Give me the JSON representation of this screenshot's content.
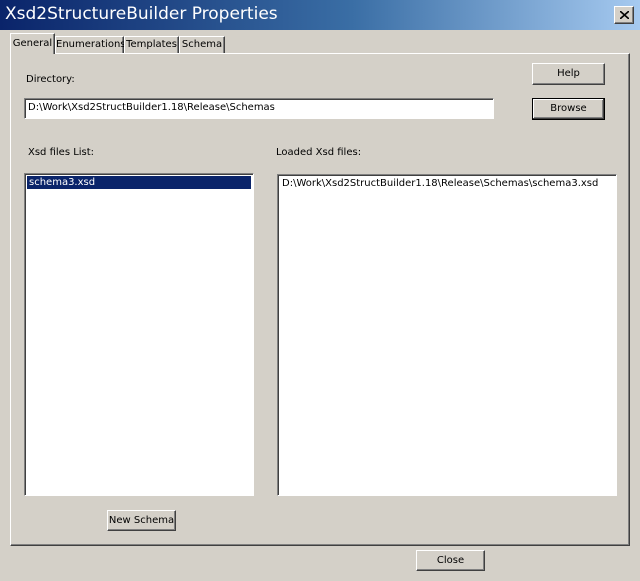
{
  "window": {
    "title": "Xsd2StructureBuilder Properties"
  },
  "tabs": [
    {
      "label": "General",
      "active": true
    },
    {
      "label": "Enumerations",
      "active": false
    },
    {
      "label": "Templates",
      "active": false
    },
    {
      "label": "Schema",
      "active": false
    }
  ],
  "general": {
    "directory_label": "Directory:",
    "directory_value": "D:\\Work\\Xsd2StructBuilder1.18\\Release\\Schemas",
    "help_label": "Help",
    "browse_label": "Browse",
    "xsd_list_label": "Xsd files List:",
    "loaded_label": "Loaded Xsd files:",
    "xsd_files": [
      "schema3.xsd"
    ],
    "loaded_files": [
      "D:\\Work\\Xsd2StructBuilder1.18\\Release\\Schemas\\schema3.xsd"
    ],
    "new_schema_label": "New Schema"
  },
  "footer": {
    "close_label": "Close"
  },
  "colors": {
    "selection": "#0a246a",
    "face": "#d4d0c8"
  }
}
